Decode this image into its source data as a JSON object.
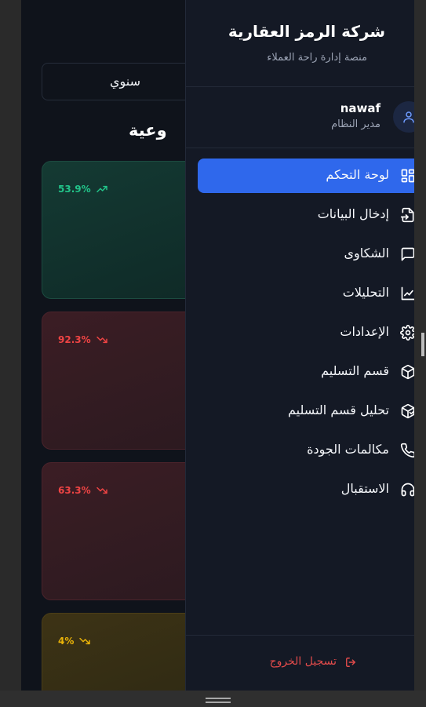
{
  "dashboard": {
    "period_value": "سنوي",
    "section_title_fragment": "وعية",
    "cards": [
      {
        "trend": "53.9%",
        "direction": "up",
        "color": "#22c58a"
      },
      {
        "trend": "92.3%",
        "direction": "down",
        "color": "#ef4444"
      },
      {
        "trend": "63.3%",
        "direction": "down",
        "color": "#ef4444"
      },
      {
        "trend": "4%",
        "direction": "down",
        "color": "#eab308"
      }
    ]
  },
  "sidebar": {
    "company_name": "شركة الرمز العقارية",
    "subtitle": "منصة إدارة راحة العملاء",
    "user": {
      "name": "nawaf",
      "role": "مدير النظام",
      "icon": "user-icon"
    },
    "items": [
      {
        "label": "لوحة التحكم",
        "icon": "dashboard-grid-icon",
        "active": true
      },
      {
        "label": "إدخال البيانات",
        "icon": "file-input-icon",
        "active": false
      },
      {
        "label": "الشكاوى",
        "icon": "message-square-icon",
        "active": false
      },
      {
        "label": "التحليلات",
        "icon": "line-chart-icon",
        "active": false
      },
      {
        "label": "الإعدادات",
        "icon": "gear-icon",
        "active": false
      },
      {
        "label": "قسم التسليم",
        "icon": "package-icon",
        "active": false
      },
      {
        "label": "تحليل قسم التسليم",
        "icon": "package-check-icon",
        "active": false
      },
      {
        "label": "مكالمات الجودة",
        "icon": "phone-icon",
        "active": false
      },
      {
        "label": "الاستقبال",
        "icon": "headphones-icon",
        "active": false
      }
    ],
    "logout_label": "تسجيل الخروج",
    "accent_color": "#2f68ec"
  }
}
